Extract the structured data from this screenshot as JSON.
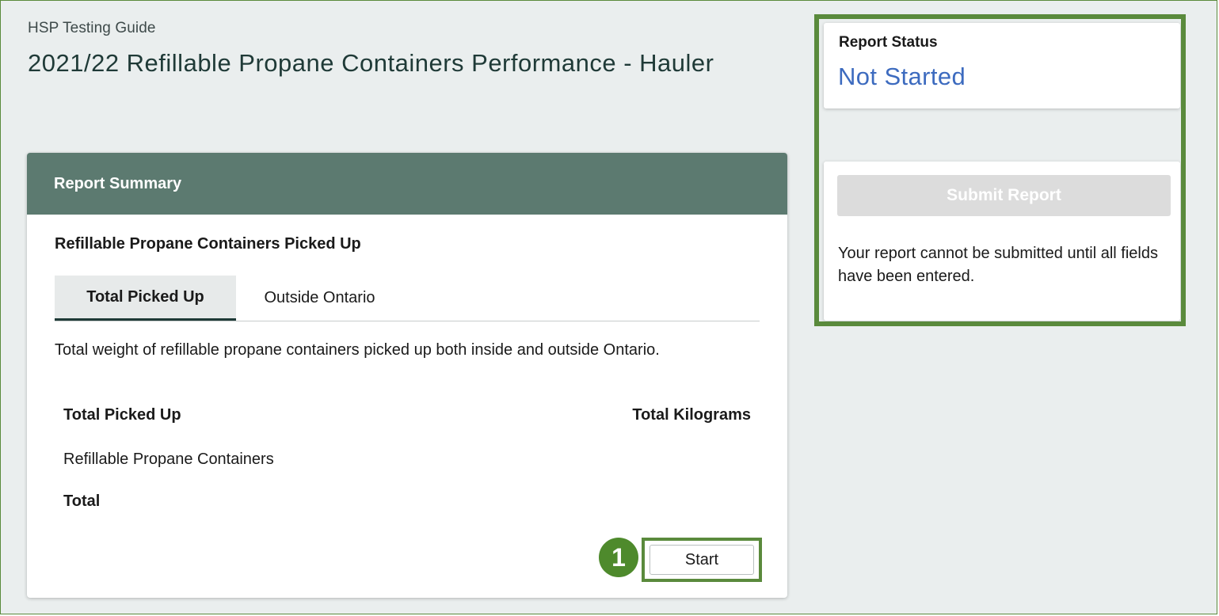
{
  "breadcrumb": "HSP Testing Guide",
  "page_title": "2021/22 Refillable Propane Containers Performance - Hauler",
  "summary": {
    "header": "Report Summary",
    "section_title": "Refillable Propane Containers Picked Up",
    "tabs": [
      {
        "label": "Total Picked Up",
        "active": true
      },
      {
        "label": "Outside Ontario",
        "active": false
      }
    ],
    "description": "Total weight of refillable propane containers picked up both inside and outside Ontario.",
    "table": {
      "col_left": "Total Picked Up",
      "col_right": "Total Kilograms",
      "row_label": "Refillable Propane Containers",
      "total_label": "Total"
    },
    "step_number": "1",
    "start_label": "Start"
  },
  "status": {
    "label": "Report Status",
    "value": "Not Started"
  },
  "submit": {
    "button_label": "Submit Report",
    "note": "Your report cannot be submitted until all fields have been entered."
  },
  "colors": {
    "header_bg": "#5c7a70",
    "highlight_green": "#5a8a3c",
    "badge_green": "#4e8a2c",
    "status_blue": "#3d6bbf",
    "disabled_button": "#dcdcdc"
  }
}
